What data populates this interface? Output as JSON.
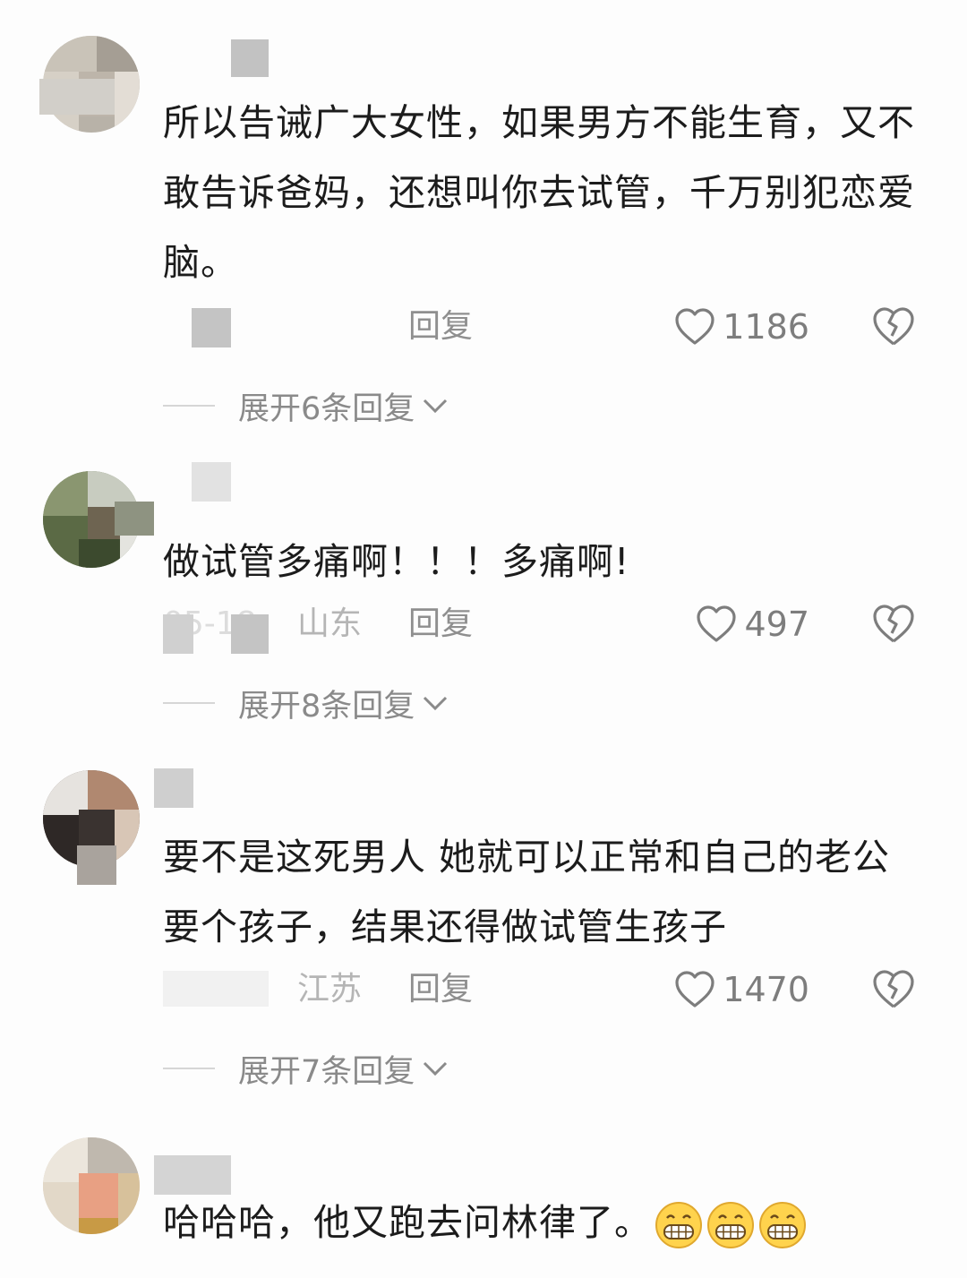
{
  "comments": [
    {
      "username": "",
      "text": "所以告诫广大女性，如果男方不能生育，又不敢告诉爸妈，还想叫你去试管，千万别犯恋爱脑。",
      "date_location": "",
      "location": "",
      "reply_label": "回复",
      "likes": "1186",
      "expand_label": "展开6条回复"
    },
    {
      "username": "",
      "text": "做试管多痛啊！！！多痛啊!",
      "date_location": "05-18",
      "location": "山东",
      "reply_label": "回复",
      "likes": "497",
      "expand_label": "展开8条回复"
    },
    {
      "username": "",
      "text": "要不是这死男人 她就可以正常和自己的老公要个孩子，结果还得做试管生孩子",
      "date_location": "",
      "location": "江苏",
      "reply_label": "回复",
      "likes": "1470",
      "expand_label": "展开7条回复"
    },
    {
      "username": "",
      "text": "哈哈哈，他又跑去问林律了。",
      "emoji_count": 3,
      "emoji_icon": "grinning-face-icon"
    }
  ],
  "colors": {
    "text": "#1c1c1c",
    "meta": "#9a9a9a",
    "icon": "#7d7d7d",
    "background": "#fdfdfd"
  }
}
